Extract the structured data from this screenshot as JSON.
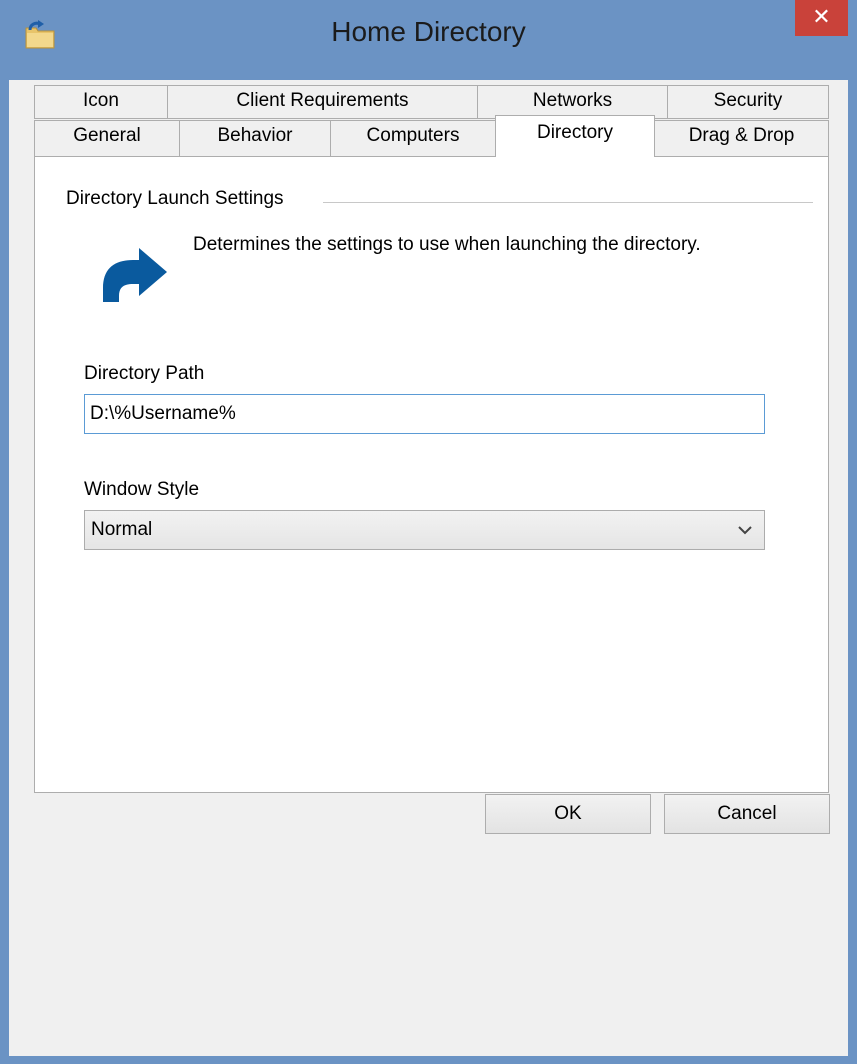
{
  "window": {
    "title": "Home Directory",
    "close_glyph": "✕",
    "accent": "#6b93c4",
    "app_icon": "folder-arrow-icon"
  },
  "tabs": {
    "row1": [
      "Icon",
      "Client Requirements",
      "Networks",
      "Security"
    ],
    "row2": [
      "General",
      "Behavior",
      "Computers",
      "Directory",
      "Drag & Drop"
    ],
    "active": "Directory"
  },
  "panel": {
    "group_title": "Directory Launch Settings",
    "description": "Determines the settings to use when launching the directory.",
    "icon": "redirect-arrow-icon",
    "icon_color": "#0a5a9e",
    "path_label": "Directory Path",
    "path_value": "D:\\%Username%",
    "style_label": "Window Style",
    "style_value": "Normal"
  },
  "buttons": {
    "ok": "OK",
    "cancel": "Cancel"
  }
}
